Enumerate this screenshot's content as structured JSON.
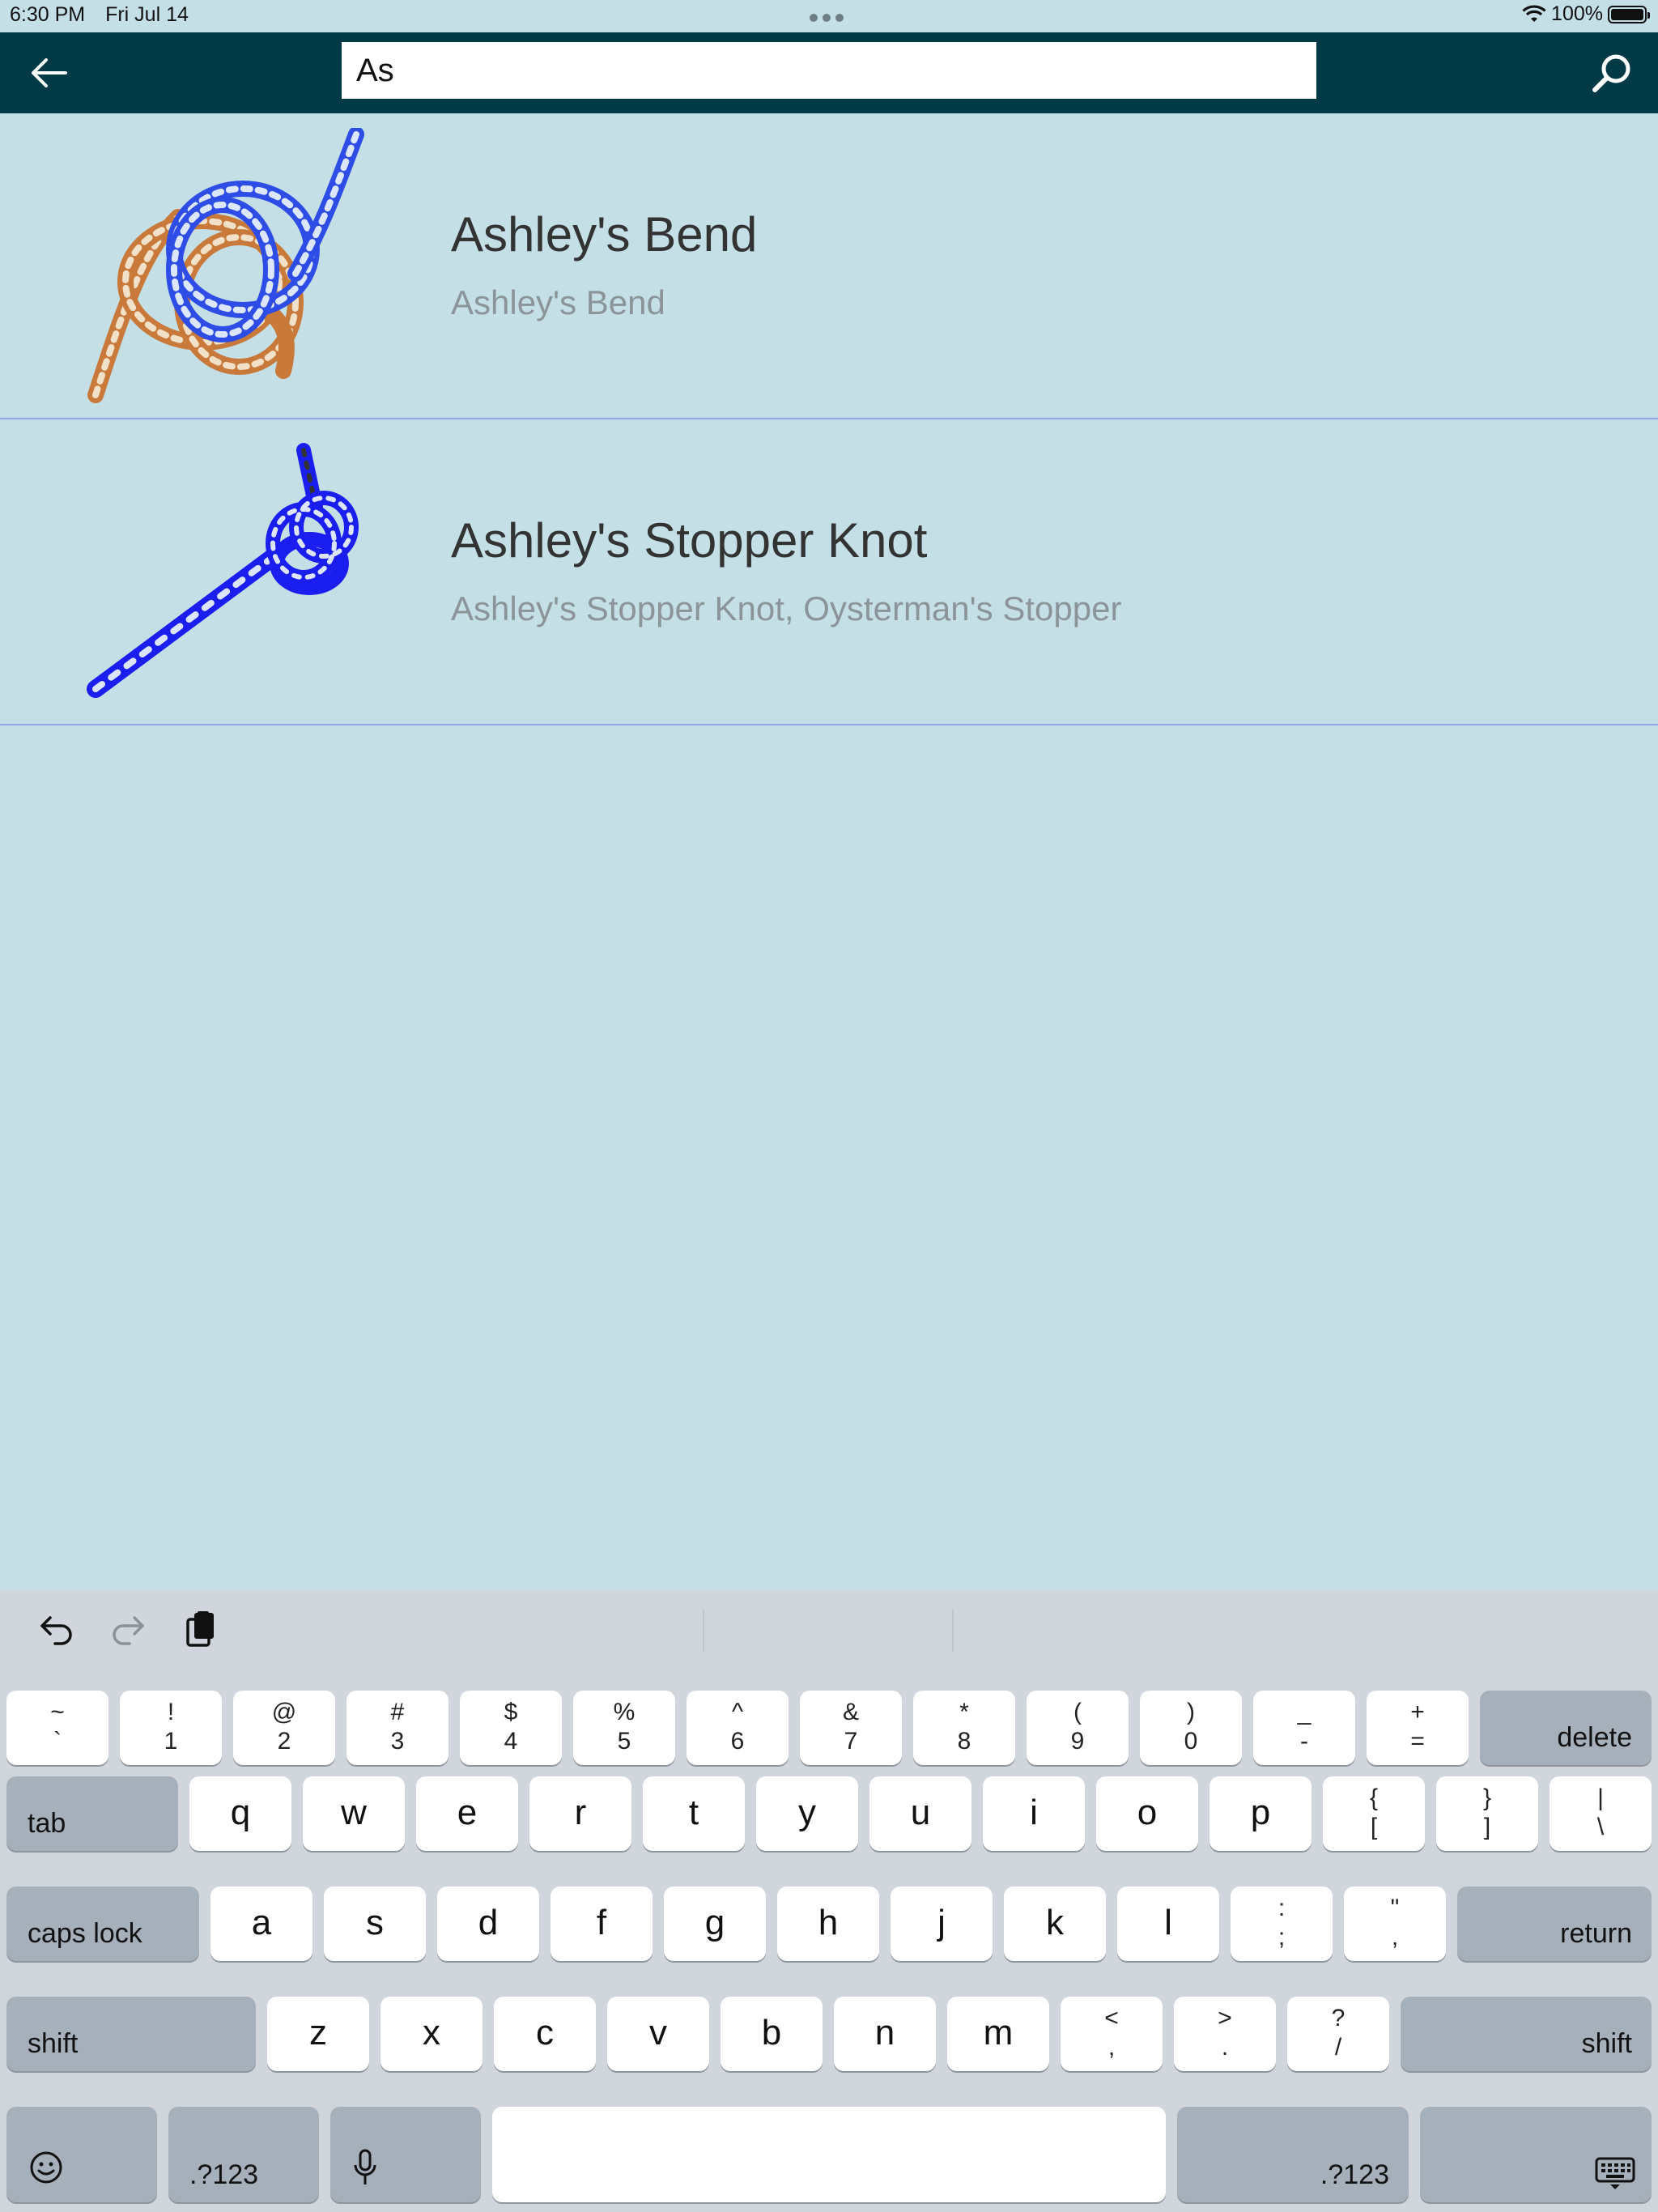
{
  "status_bar": {
    "time": "6:30 PM",
    "date": "Fri Jul 14",
    "battery": "100%"
  },
  "navbar": {
    "search_value": "As"
  },
  "results": [
    {
      "title": "Ashley's Bend",
      "subtitle": "Ashley's Bend"
    },
    {
      "title": "Ashley's Stopper Knot",
      "subtitle": "Ashley's Stopper Knot, Oysterman's Stopper"
    }
  ],
  "keyboard": {
    "number_row": [
      {
        "top": "~",
        "bot": "`"
      },
      {
        "top": "!",
        "bot": "1"
      },
      {
        "top": "@",
        "bot": "2"
      },
      {
        "top": "#",
        "bot": "3"
      },
      {
        "top": "$",
        "bot": "4"
      },
      {
        "top": "%",
        "bot": "5"
      },
      {
        "top": "^",
        "bot": "6"
      },
      {
        "top": "&",
        "bot": "7"
      },
      {
        "top": "*",
        "bot": "8"
      },
      {
        "top": "(",
        "bot": "9"
      },
      {
        "top": ")",
        "bot": "0"
      },
      {
        "top": "_",
        "bot": "-"
      },
      {
        "top": "+",
        "bot": "="
      }
    ],
    "delete": "delete",
    "tab": "tab",
    "q_row": [
      "q",
      "w",
      "e",
      "r",
      "t",
      "y",
      "u",
      "i",
      "o",
      "p"
    ],
    "q_row_sym": [
      {
        "top": "{",
        "bot": "["
      },
      {
        "top": "}",
        "bot": "]"
      },
      {
        "top": "|",
        "bot": "\\"
      }
    ],
    "caps_lock": "caps lock",
    "a_row": [
      "a",
      "s",
      "d",
      "f",
      "g",
      "h",
      "j",
      "k",
      "l"
    ],
    "a_row_sym": [
      {
        "top": ":",
        "bot": ";"
      },
      {
        "top": "\"",
        "bot": ","
      }
    ],
    "return": "return",
    "shift": "shift",
    "z_row": [
      "z",
      "x",
      "c",
      "v",
      "b",
      "n",
      "m"
    ],
    "z_row_sym": [
      {
        "top": "<",
        "bot": ","
      },
      {
        "top": ">",
        "bot": "."
      },
      {
        "top": "?",
        "bot": "/"
      }
    ],
    "numbers": ".?123"
  }
}
